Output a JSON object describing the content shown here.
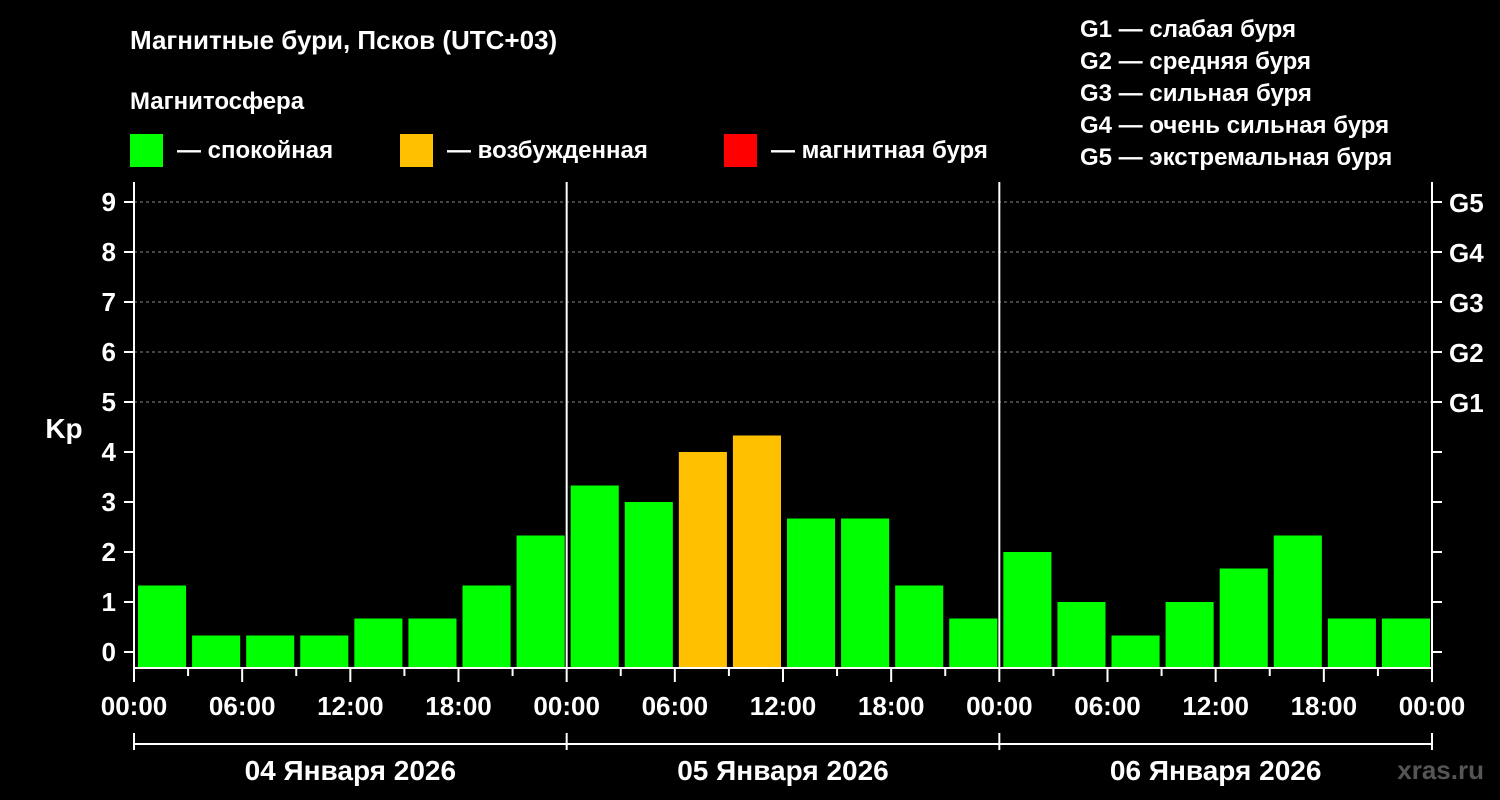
{
  "colors": {
    "background": "#000000",
    "foreground": "#ffffff",
    "quiet": "#00ff00",
    "unsettled": "#ffc000",
    "storm": "#ff0000",
    "grid": "#888888"
  },
  "header": {
    "title": "Магнитные бури, Псков (UTC+03)",
    "subtitle": "Магнитосфера"
  },
  "legend": [
    {
      "label": "— спокойная",
      "color": "#00ff00"
    },
    {
      "label": "— возбужденная",
      "color": "#ffc000"
    },
    {
      "label": "— магнитная буря",
      "color": "#ff0000"
    }
  ],
  "g_scale": [
    "G1 — слабая буря",
    "G2 — средняя буря",
    "G3 — сильная буря",
    "G4 — очень сильная буря",
    "G5 — экстремальная буря"
  ],
  "watermark": "xras.ru",
  "chart_data": {
    "type": "bar",
    "ylabel": "Kp",
    "ylim": [
      0,
      9
    ],
    "y_ticks": [
      0,
      1,
      2,
      3,
      4,
      5,
      6,
      7,
      8,
      9
    ],
    "right_ticks": [
      {
        "value": 5,
        "label": "G1"
      },
      {
        "value": 6,
        "label": "G2"
      },
      {
        "value": 7,
        "label": "G3"
      },
      {
        "value": 8,
        "label": "G4"
      },
      {
        "value": 9,
        "label": "G5"
      }
    ],
    "grid": "dashed horizontal at 5-9",
    "x_tick_labels": [
      "00:00",
      "06:00",
      "12:00",
      "18:00",
      "00:00",
      "06:00",
      "12:00",
      "18:00",
      "00:00",
      "06:00",
      "12:00",
      "18:00",
      "00:00"
    ],
    "days": [
      "04 Января 2026",
      "05 Января 2026",
      "06 Января 2026"
    ],
    "interval_hours": 3,
    "values": [
      1.33,
      0.33,
      0.33,
      0.33,
      0.67,
      0.67,
      1.33,
      2.33,
      3.33,
      3.0,
      4.0,
      4.33,
      2.67,
      2.67,
      1.33,
      0.67,
      2.0,
      1.0,
      0.33,
      1.0,
      1.67,
      2.33,
      0.67,
      0.67
    ],
    "levels": [
      "quiet",
      "quiet",
      "quiet",
      "quiet",
      "quiet",
      "quiet",
      "quiet",
      "quiet",
      "quiet",
      "quiet",
      "unsettled",
      "unsettled",
      "quiet",
      "quiet",
      "quiet",
      "quiet",
      "quiet",
      "quiet",
      "quiet",
      "quiet",
      "quiet",
      "quiet",
      "quiet",
      "quiet"
    ]
  }
}
